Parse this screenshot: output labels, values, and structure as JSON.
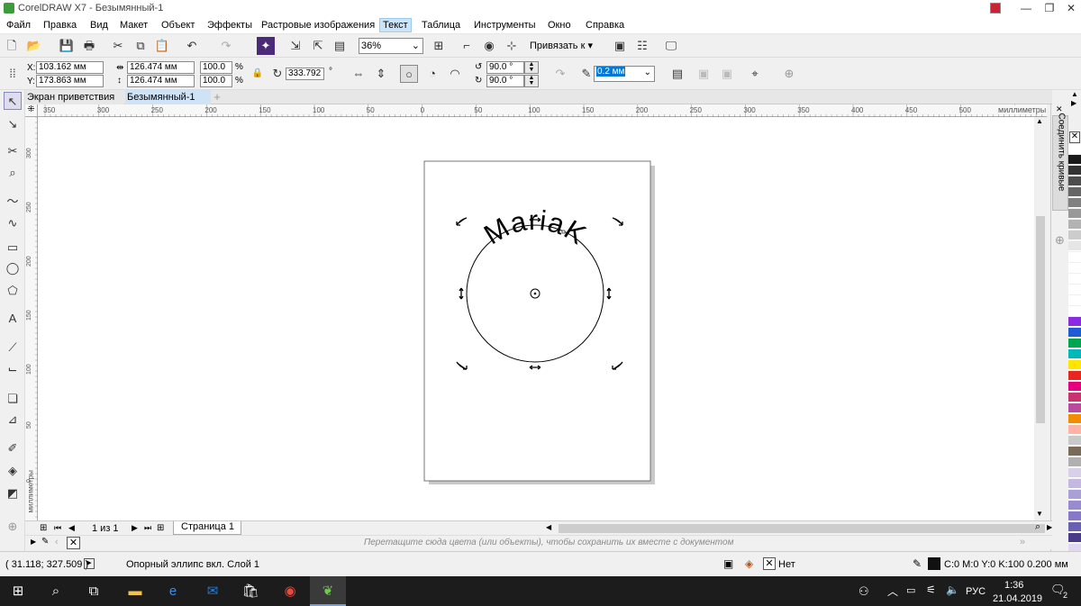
{
  "window": {
    "title": "CorelDRAW X7 - Безымянный-1"
  },
  "menu": [
    "Файл",
    "Правка",
    "Вид",
    "Макет",
    "Объект",
    "Эффекты",
    "Растровые изображения",
    "Текст",
    "Таблица",
    "Инструменты",
    "Окно",
    "Справка"
  ],
  "toolbar": {
    "zoom": "36%",
    "snap_label": "Привязать к"
  },
  "props": {
    "x_label": "X:",
    "x": "103.162 мм",
    "y_label": "Y:",
    "y": "173.863 мм",
    "width": "126.474 мм",
    "height": "126.474 мм",
    "scale_x": "100.0",
    "scale_y": "100.0",
    "pct": "%",
    "angle": "333.792",
    "deg": "°",
    "start_angle": "90.0 °",
    "end_angle": "90.0 °",
    "outline": "0.2 мм"
  },
  "tabs": {
    "welcome": "Экран приветствия",
    "doc": "Безымянный-1",
    "add": "+"
  },
  "rulers": {
    "h_ticks": [
      "350",
      "300",
      "250",
      "200",
      "150",
      "100",
      "50",
      "0",
      "50",
      "100",
      "150",
      "200",
      "250",
      "300",
      "350",
      "400",
      "450",
      "500"
    ],
    "units": "миллиметры",
    "v_ticks": [
      "300",
      "250",
      "200",
      "150",
      "100",
      "50",
      "0"
    ],
    "v_units": "миллиметры"
  },
  "canvas": {
    "text": "MariaK"
  },
  "dock": {
    "label": "Соединить кривые"
  },
  "pagenav": {
    "count": "1 из 1",
    "page_tab": "Страница 1"
  },
  "docpalette": {
    "hint": "Перетащите сюда цвета (или объекты), чтобы сохранить их вместе с документом"
  },
  "status": {
    "coords": "( 31.118; 327.509 )",
    "info": "Опорный эллипс вкл. Слой 1",
    "fill": "Нет",
    "outline": "C:0 M:0 Y:0 K:100  0.200 мм"
  },
  "taskbar": {
    "lang": "РУС",
    "time": "1:36",
    "date": "21.04.2019",
    "notif": "2"
  },
  "palette_colors": [
    "#ffffff",
    "#1a1a1a",
    "#333333",
    "#4d4d4d",
    "#666666",
    "#808080",
    "#999999",
    "#b3b3b3",
    "#cccccc",
    "#e6e6e6",
    "#ffffff",
    "#ffffff",
    "#ffffff",
    "#ffffff",
    "#ffffff",
    "#ffffff",
    "#8a2be2",
    "#1e5bd6",
    "#00a550",
    "#00b8b8",
    "#ffe600",
    "#e8281c",
    "#e6007e",
    "#c8326e",
    "#b84b9c",
    "#f28c00",
    "#ffb3a7",
    "#c9c9c9",
    "#7a6a5a",
    "#b0b0b0",
    "#d8d0e8",
    "#c4b8e0",
    "#aaa0d8",
    "#9a8ad0",
    "#8878c8",
    "#6860b0",
    "#4a3a8a",
    "#e0d8f0",
    "#9988cc",
    "#7766bb"
  ]
}
